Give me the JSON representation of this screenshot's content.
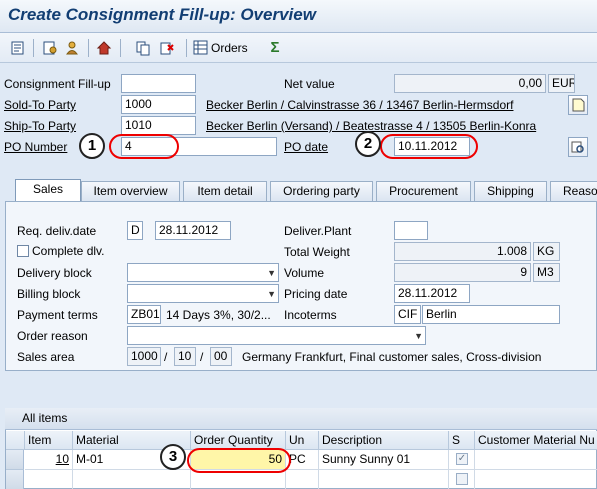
{
  "window": {
    "title": "Create Consignment Fill-up: Overview"
  },
  "toolbar": {
    "orders_label": "Orders"
  },
  "header": {
    "consignment_fillup_label": "Consignment Fill-up",
    "consignment_fillup_value": "",
    "net_value_label": "Net value",
    "net_value": "0,00",
    "currency": "EUR",
    "sold_to_label": "Sold-To Party",
    "sold_to_value": "1000",
    "sold_to_desc": "Becker Berlin / Calvinstrasse 36 / 13467 Berlin-Hermsdorf",
    "ship_to_label": "Ship-To Party",
    "ship_to_value": "1010",
    "ship_to_desc": "Becker Berlin (Versand) / Beatestrasse 4 / 13505 Berlin-Konra",
    "po_number_label": "PO Number",
    "po_number_value": "4",
    "po_date_label": "PO date",
    "po_date_value": "10.11.2012"
  },
  "callouts": [
    "1",
    "2",
    "3"
  ],
  "tabs": [
    {
      "label": "Sales",
      "active": true
    },
    {
      "label": "Item overview"
    },
    {
      "label": "Item detail"
    },
    {
      "label": "Ordering party"
    },
    {
      "label": "Procurement"
    },
    {
      "label": "Shipping"
    },
    {
      "label": "Reaso"
    }
  ],
  "sales": {
    "req_deliv_date_label": "Req. deliv.date",
    "req_deliv_date_type": "D",
    "req_deliv_date_value": "28.11.2012",
    "deliver_plant_label": "Deliver.Plant",
    "deliver_plant_value": "",
    "complete_dlv_label": "Complete dlv.",
    "total_weight_label": "Total Weight",
    "total_weight_value": "1.008",
    "total_weight_unit": "KG",
    "delivery_block_label": "Delivery block",
    "delivery_block_value": "",
    "volume_label": "Volume",
    "volume_value": "9",
    "volume_unit": "M3",
    "billing_block_label": "Billing block",
    "billing_block_value": "",
    "pricing_date_label": "Pricing date",
    "pricing_date_value": "28.11.2012",
    "payment_terms_label": "Payment terms",
    "payment_terms_code": "ZB01",
    "payment_terms_desc": "14 Days 3%, 30/2...",
    "incoterms_label": "Incoterms",
    "incoterms_code": "CIF",
    "incoterms_place": "Berlin",
    "order_reason_label": "Order reason",
    "order_reason_value": "",
    "sales_area_label": "Sales area",
    "sales_org": "1000",
    "dist_channel": "10",
    "division": "00",
    "sep": "/",
    "sales_area_desc": "Germany Frankfurt, Final customer sales, Cross-division"
  },
  "items": {
    "title": "All items",
    "columns": [
      "Item",
      "Material",
      "Order Quantity",
      "Un",
      "Description",
      "S",
      "Customer Material Nu"
    ],
    "rows": [
      {
        "item": "10",
        "material": "M-01",
        "qty": "50",
        "unit": "PC",
        "description": "Sunny Sunny 01"
      }
    ]
  }
}
